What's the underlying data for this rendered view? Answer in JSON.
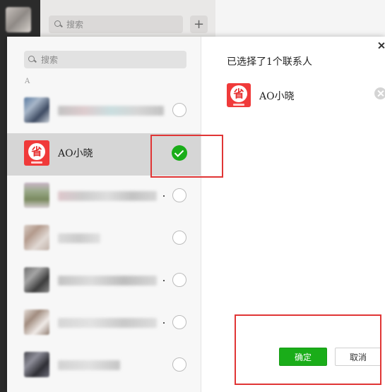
{
  "background": {
    "search_placeholder": "搜索",
    "plus_label": "+"
  },
  "dialog": {
    "search_placeholder": "搜索",
    "section_letter": "A",
    "contacts": [
      {
        "name": "",
        "selected": false
      },
      {
        "name": "AO小晓",
        "selected": true
      },
      {
        "name": "",
        "selected": false
      },
      {
        "name": "",
        "selected": false
      },
      {
        "name": "",
        "selected": false
      },
      {
        "name": "",
        "selected": false
      },
      {
        "name": "",
        "selected": false
      }
    ],
    "selected_title": "已选择了1个联系人",
    "selected_contact": {
      "name": "AO小晓"
    },
    "logo_char": "省",
    "confirm_label": "确定",
    "cancel_label": "取消"
  },
  "colors": {
    "accent_green": "#1aad19",
    "highlight_red": "#e03535",
    "logo_red": "#f03a3a"
  }
}
